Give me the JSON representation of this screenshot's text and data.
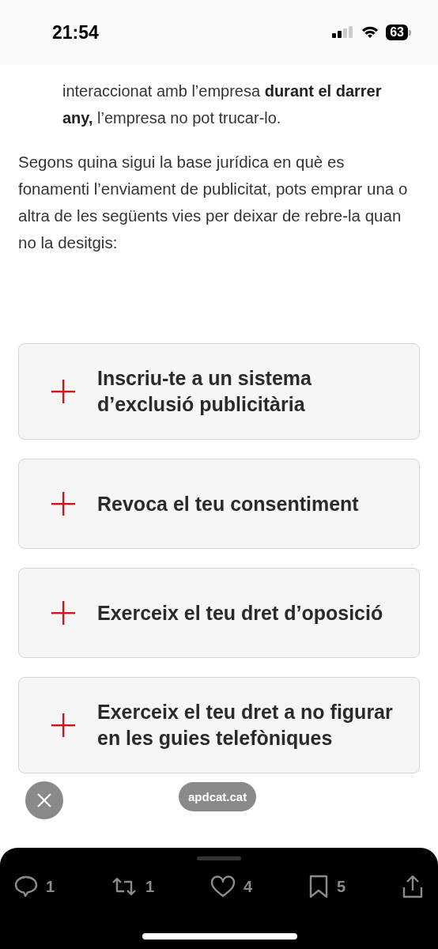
{
  "status_bar": {
    "time": "21:54",
    "battery": "63"
  },
  "intro_tail": "interaccionat amb l’empresa **durant el darrer any,** l’empresa no pot trucar-lo.",
  "paragraph": "Segons quina sigui la base jurídica en què es fonamenti l’enviament de publicitat, pots emprar una o altra de les següents vies per deixar de rebre-la quan no la desitgis:",
  "accordions": [
    {
      "title": "Inscriu-te a un sistema d’exclusió publicitària",
      "expanded": false
    },
    {
      "title": "Revoca el teu consentiment",
      "expanded": false
    },
    {
      "title": "Exerceix el teu dret d’oposició",
      "expanded": false
    },
    {
      "title": "Exerceix el teu dret a no figurar en les guies telefòniques",
      "expanded": false
    }
  ],
  "domain_pill": "apdcat.cat",
  "actions": [
    {
      "kind": "reply",
      "count": "1"
    },
    {
      "kind": "repost",
      "count": "1"
    },
    {
      "kind": "like",
      "count": "4"
    },
    {
      "kind": "bookmark",
      "count": "5"
    },
    {
      "kind": "share"
    }
  ]
}
